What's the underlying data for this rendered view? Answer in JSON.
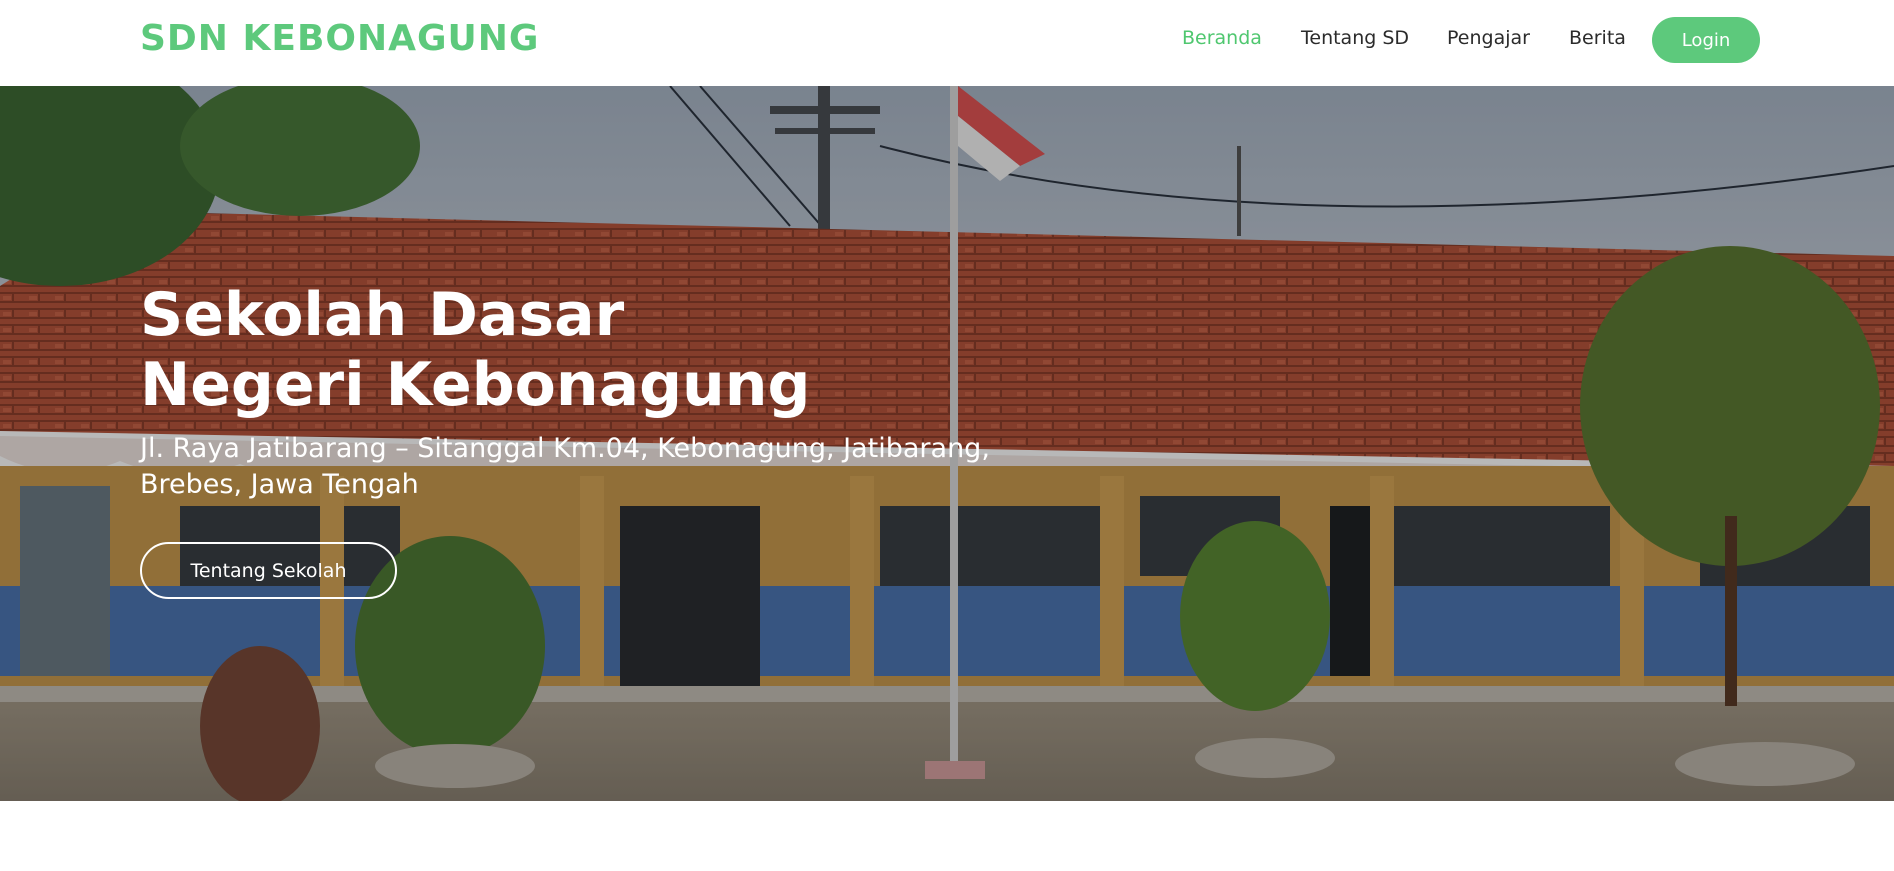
{
  "navbar": {
    "brand": "SDN KEBONAGUNG",
    "links": [
      {
        "label": "Beranda",
        "active": true
      },
      {
        "label": "Tentang SD",
        "active": false
      },
      {
        "label": "Pengajar",
        "active": false
      },
      {
        "label": "Berita",
        "active": false
      }
    ],
    "login_label": "Login"
  },
  "hero": {
    "title_line1": "Sekolah Dasar",
    "title_line2": "Negeri Kebonagung",
    "address_line1": "Jl. Raya Jatibarang – Sitanggal Km.04, Kebonagung, Jatibarang,",
    "address_line2": "Brebes, Jawa Tengah",
    "cta_label": "Tentang Sekolah"
  },
  "colors": {
    "accent": "#5dc97c",
    "nav_text": "#2b2b2b",
    "hero_text": "#ffffff"
  }
}
